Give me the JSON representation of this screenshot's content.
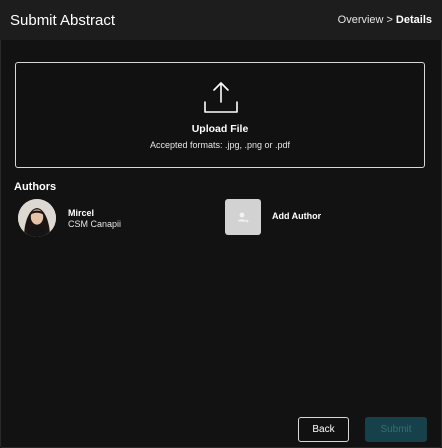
{
  "header": {
    "title": "Submit Abstract",
    "breadcrumb": [
      "Overview",
      "Details"
    ],
    "breadcrumb_separator": ">"
  },
  "upload": {
    "icon": "upload-icon",
    "title": "Upload File",
    "subtitle": "Accepted formats: .jpg, .png or .pdf"
  },
  "authors": {
    "label": "Authors",
    "items": [
      {
        "name": "Mircel",
        "organization": "CSM Canapii"
      }
    ],
    "add_label": "Add Author",
    "add_icon": "person-placeholder-icon"
  },
  "footer": {
    "back_label": "Back",
    "submit_label": "Submit",
    "submit_enabled": false
  },
  "colors": {
    "background": "#141414",
    "header": "#1d1d1d",
    "submit_disabled_bg": "#17414a",
    "submit_disabled_text": "#2f6f7c"
  }
}
